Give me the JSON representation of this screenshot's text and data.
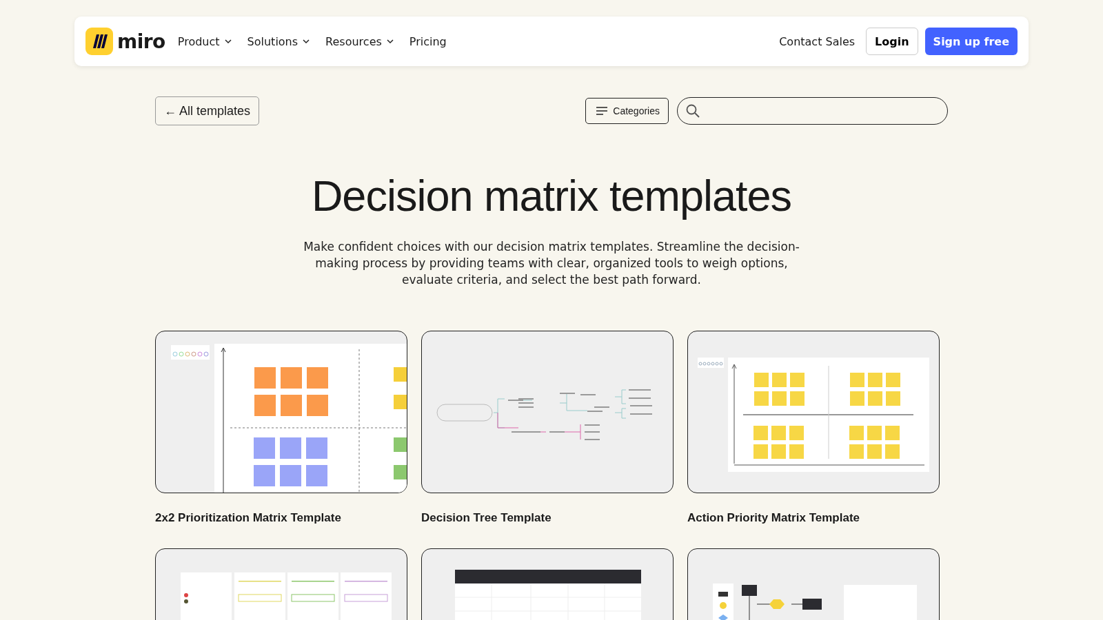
{
  "nav": {
    "logo": "miro",
    "items": [
      {
        "label": "Product",
        "has_menu": true
      },
      {
        "label": "Solutions",
        "has_menu": true
      },
      {
        "label": "Resources",
        "has_menu": true
      },
      {
        "label": "Pricing",
        "has_menu": false
      }
    ],
    "contact": "Contact Sales",
    "login": "Login",
    "signup": "Sign up free"
  },
  "toolbar": {
    "back": "← All templates",
    "categories": "Categories"
  },
  "hero": {
    "title": "Decision matrix templates",
    "description": "Make confident choices with our decision matrix templates. Streamline the decision-making process by providing teams with clear, organized tools to weigh options, evaluate criteria, and select the best path forward."
  },
  "templates": [
    {
      "title": "2x2 Prioritization Matrix Template",
      "kind": "matrix"
    },
    {
      "title": "Decision Tree Template",
      "kind": "tree"
    },
    {
      "title": "Action Priority Matrix Template",
      "kind": "priority"
    },
    {
      "kind": "objectives"
    },
    {
      "kind": "table"
    },
    {
      "kind": "flowchart"
    }
  ]
}
